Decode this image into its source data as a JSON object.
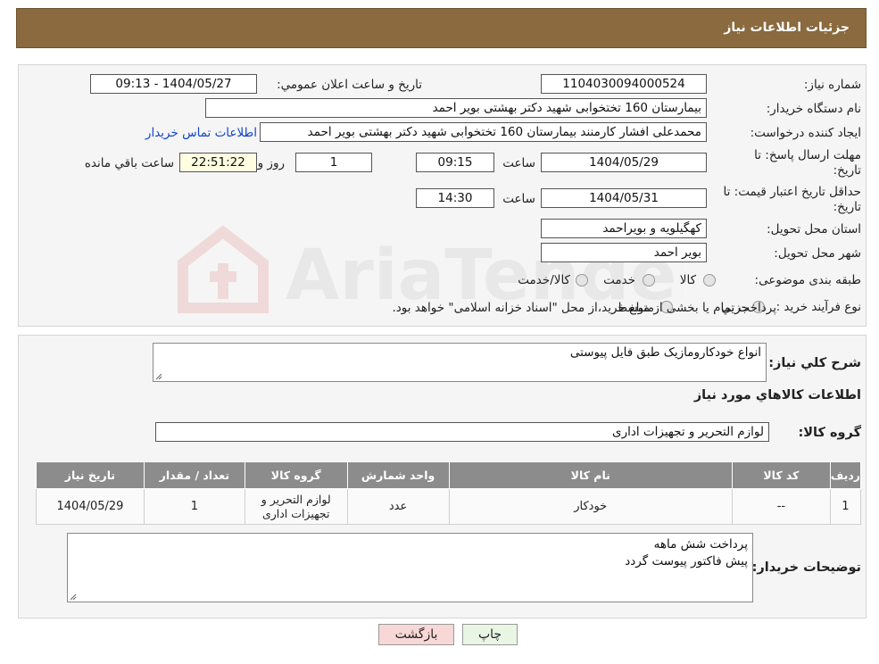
{
  "header": {
    "title": "جزئيات اطلاعات نياز"
  },
  "need_number": {
    "label": "شماره نياز:",
    "value": "1104030094000524"
  },
  "announce": {
    "label": "تاريخ و ساعت اعلان عمومي:",
    "value": "1404/05/27 - 09:13"
  },
  "buyer": {
    "label": "نام دستگاه خريدار:",
    "value": "بيمارستان 160 تختخوابی شهيد دکتر بهشتی بوير احمد"
  },
  "creator": {
    "label": "ايجاد کننده درخواست:",
    "value": "محمدعلی افشار کارمنند بيمارستان 160 تختخوابی شهيد دکتر بهشتی بوير احمد",
    "contact_link": "اطلاعات تماس خريدار"
  },
  "reply_deadline": {
    "label_line1": "مهلت ارسال پاسخ: تا",
    "label_line2": "تاريخ:",
    "date": "1404/05/29",
    "time_label": "ساعت",
    "time": "09:15",
    "days": "1",
    "days_label": "روز و",
    "remaining": "22:51:22",
    "remaining_label": "ساعت باقي مانده"
  },
  "price_validity": {
    "label_line1": "حداقل تاريخ اعتبار قيمت: تا",
    "label_line2": "تاريخ:",
    "date": "1404/05/31",
    "time_label": "ساعت",
    "time": "14:30"
  },
  "province": {
    "label": "استان محل تحويل:",
    "value": "کهگيلويه و بويراحمد"
  },
  "city": {
    "label": "شهر محل تحويل:",
    "value": "بوير احمد"
  },
  "category": {
    "label": "طبقه بندی موضوعی:",
    "options": [
      "کالا",
      "خدمت",
      "کالا/خدمت"
    ]
  },
  "purchase_type": {
    "label": "نوع فرآيند خريد :",
    "options": [
      "جزيي",
      "متوسط"
    ],
    "note": "پرداخت تمام يا بخشی از مبلغ خريد،از محل \"اسناد خزانه اسلامی\" خواهد بود."
  },
  "description": {
    "label": "شرح کلي نياز:",
    "value": "انواع خودکارومازیک طبق فایل پیوستی"
  },
  "goods_section": {
    "title": "اطلاعات کالاهاي مورد نياز"
  },
  "goods_group": {
    "label": "گروه کالا:",
    "value": "لوازم التحرير و تجهيزات اداری"
  },
  "table": {
    "headers": [
      "رديف",
      "کد کالا",
      "نام کالا",
      "واحد شمارش",
      "گروه کالا",
      "تعداد / مقدار",
      "تاريخ نياز"
    ],
    "rows": [
      {
        "row": "1",
        "code": "--",
        "name": "خودکار",
        "unit": "عدد",
        "group_line1": "لوازم التحرير و",
        "group_line2": "تجهيزات اداری",
        "qty": "1",
        "date": "1404/05/29"
      }
    ]
  },
  "buyer_notes": {
    "label": "توضيحات خريدار:",
    "line1": "پرداخت شش ماهه",
    "line2": "پیش فاکتور پیوست گردد"
  },
  "buttons": {
    "print": "چاپ",
    "back": "بازگشت"
  },
  "watermark_text": "AriaTender.neT",
  "colors": {
    "header_bg": "#8a6a3e",
    "table_header_bg": "#8c8c8c",
    "link": "#1144cc",
    "back_btn": "#f8d7d7",
    "print_btn": "#eaf6e4"
  }
}
